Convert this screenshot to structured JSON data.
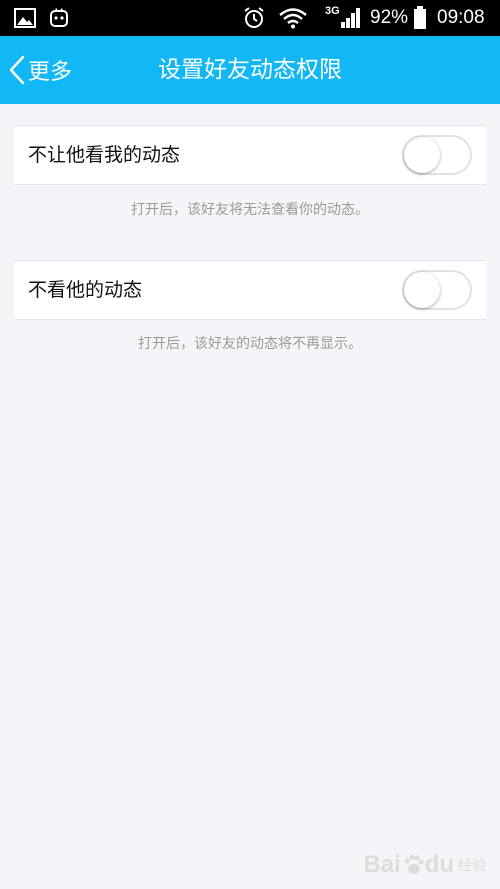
{
  "status_bar": {
    "network": "3G",
    "battery": "92%",
    "time": "09:08"
  },
  "nav": {
    "back_label": "更多",
    "title": "设置好友动态权限"
  },
  "settings": [
    {
      "label": "不让他看我的动态",
      "enabled": false,
      "hint": "打开后，该好友将无法查看你的动态。"
    },
    {
      "label": "不看他的动态",
      "enabled": false,
      "hint": "打开后，该好友的动态将不再显示。"
    }
  ],
  "watermark": {
    "brand": "Bai",
    "brand_suffix": "du",
    "sub": "经验"
  },
  "colors": {
    "nav_bg": "#12b7f5",
    "page_bg": "#f4f5f9",
    "hint_text": "#9a9a9a"
  }
}
